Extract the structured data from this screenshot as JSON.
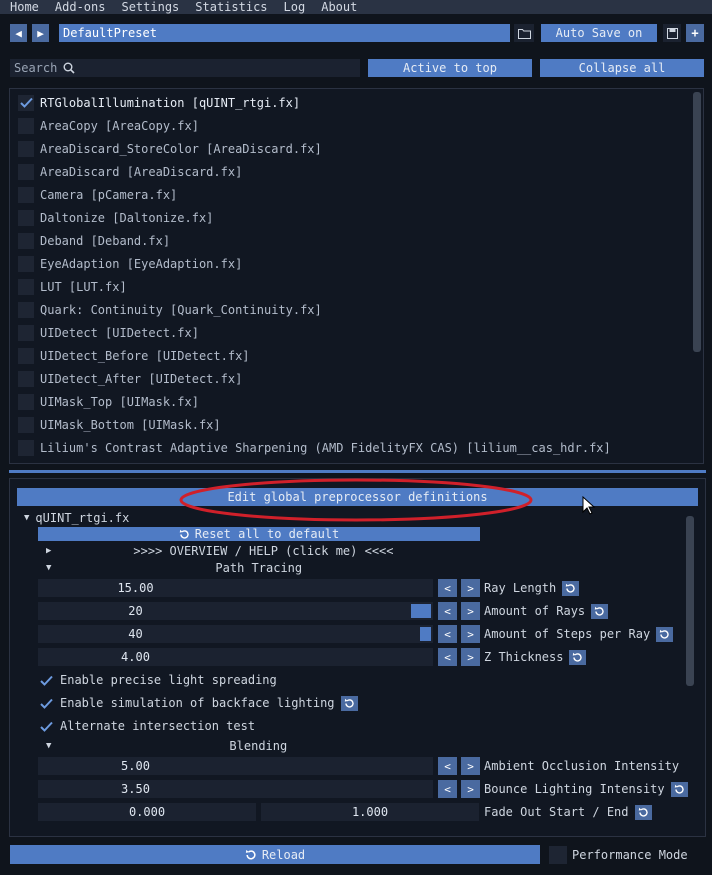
{
  "menu": [
    "Home",
    "Add-ons",
    "Settings",
    "Statistics",
    "Log",
    "About"
  ],
  "toolbar": {
    "prev": "◀",
    "next": "▶",
    "preset": "DefaultPreset",
    "autosave": "Auto Save on",
    "add": "+"
  },
  "search": {
    "placeholder": "Search"
  },
  "buttons": {
    "active_to_top": "Active to top",
    "collapse_all": "Collapse all"
  },
  "effects": [
    {
      "label": "RTGlobalIllumination [qUINT_rtgi.fx]",
      "checked": true
    },
    {
      "label": "AreaCopy [AreaCopy.fx]",
      "checked": false
    },
    {
      "label": "AreaDiscard_StoreColor [AreaDiscard.fx]",
      "checked": false
    },
    {
      "label": "AreaDiscard [AreaDiscard.fx]",
      "checked": false
    },
    {
      "label": "Camera [pCamera.fx]",
      "checked": false
    },
    {
      "label": "Daltonize [Daltonize.fx]",
      "checked": false
    },
    {
      "label": "Deband [Deband.fx]",
      "checked": false
    },
    {
      "label": "EyeAdaption [EyeAdaption.fx]",
      "checked": false
    },
    {
      "label": "LUT [LUT.fx]",
      "checked": false
    },
    {
      "label": "Quark: Continuity [Quark_Continuity.fx]",
      "checked": false
    },
    {
      "label": "UIDetect [UIDetect.fx]",
      "checked": false
    },
    {
      "label": "UIDetect_Before [UIDetect.fx]",
      "checked": false
    },
    {
      "label": "UIDetect_After [UIDetect.fx]",
      "checked": false
    },
    {
      "label": "UIMask_Top [UIMask.fx]",
      "checked": false
    },
    {
      "label": "UIMask_Bottom [UIMask.fx]",
      "checked": false
    },
    {
      "label": "Lilium's Contrast Adaptive Sharpening (AMD FidelityFX CAS) [lilium__cas_hdr.fx]",
      "checked": false
    }
  ],
  "panel": {
    "edit_global": "Edit global preprocessor definitions",
    "effect_title": "qUINT_rtgi.fx",
    "reset_all": "Reset all to default",
    "overview": ">>>> OVERVIEW / HELP (click me) <<<<",
    "section_path": "Path Tracing",
    "section_blending": "Blending",
    "params": [
      {
        "value": "15.00",
        "label": "Ray Length",
        "fill": 0
      },
      {
        "value": "20",
        "label": "Amount of Rays",
        "fill": 1
      },
      {
        "value": "40",
        "label": "Amount of Steps per Ray",
        "fill": 1
      },
      {
        "value": "4.00",
        "label": "Z Thickness",
        "fill": 0
      }
    ],
    "checks": [
      {
        "label": "Enable precise light spreading",
        "reset": false
      },
      {
        "label": "Enable simulation of backface lighting",
        "reset": true
      },
      {
        "label": "Alternate intersection test",
        "reset": false
      }
    ],
    "blend_params": [
      {
        "value": "5.00",
        "label": "Ambient Occlusion Intensity"
      },
      {
        "value": "3.50",
        "label": "Bounce Lighting Intensity"
      }
    ],
    "fade": {
      "start": "0.000",
      "end": "1.000",
      "label": "Fade Out Start / End"
    },
    "lt": "<",
    "gt": ">"
  },
  "footer": {
    "reload": "Reload",
    "performance_mode": "Performance Mode"
  },
  "colors": {
    "accent": "#4f7bc4",
    "highlight_ring": "#d0202a"
  }
}
